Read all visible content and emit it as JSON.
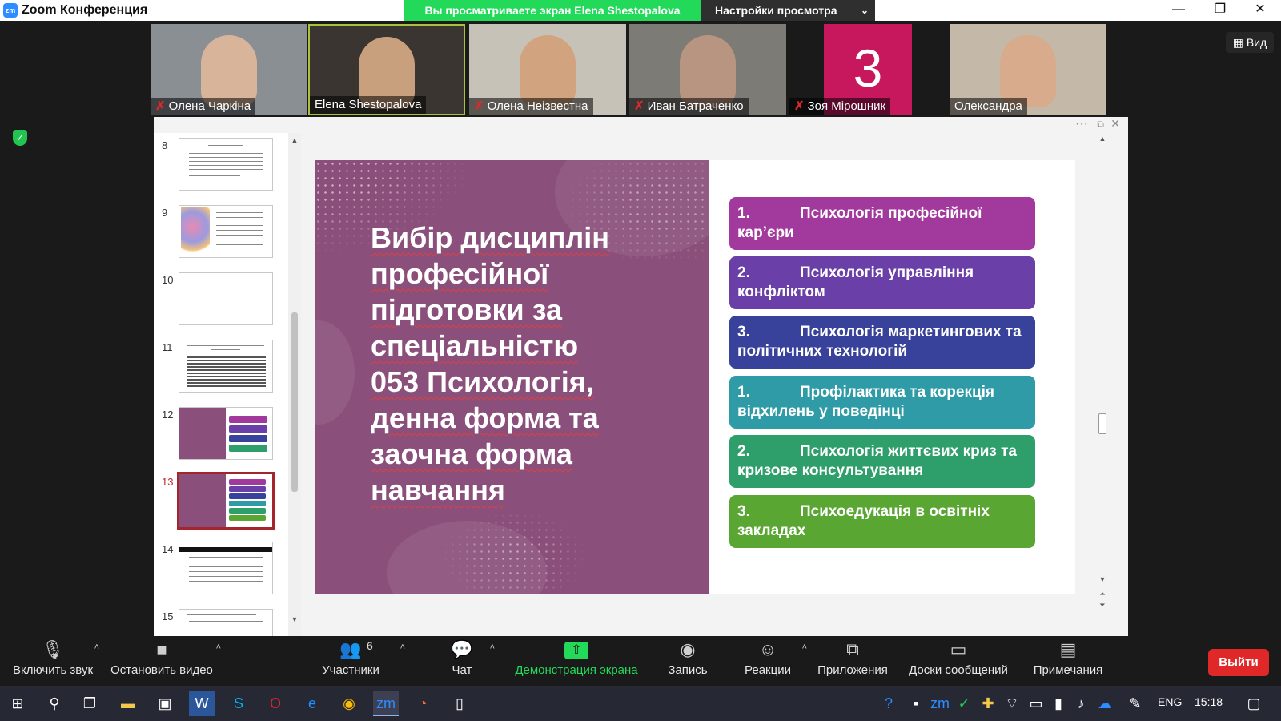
{
  "window": {
    "app_title": "Zoom Конференция",
    "minimize": "—",
    "restore": "❐",
    "close": "✕"
  },
  "share_bar": {
    "banner": "Вы просматриваете экран Elena Shestopalova",
    "view_settings": "Настройки просмотра",
    "chevron": "⌄"
  },
  "view_button": {
    "label": "▦ Вид"
  },
  "participants": [
    {
      "name": "Олена Чаркіна",
      "muted": true,
      "bg": "#8a8f94",
      "face": "#d8b59a"
    },
    {
      "name": "Elena Shestopalova",
      "muted": false,
      "active": true,
      "bg": "#3a3530",
      "face": "#c9a07e"
    },
    {
      "name": "Олена Неізвестна",
      "muted": true,
      "bg": "#c7c2b8",
      "face": "#d1a47f"
    },
    {
      "name": "Иван Батраченко",
      "muted": true,
      "bg": "#7c7b76",
      "face": "#b89580"
    },
    {
      "name": "Зоя Мірошник",
      "muted": true,
      "avatar": "3"
    },
    {
      "name": "Олександра",
      "muted": false,
      "bg": "#c4b8a8",
      "face": "#d8ab8c"
    }
  ],
  "mute_glyph": "✗",
  "thumbnails": [
    {
      "num": "8"
    },
    {
      "num": "9"
    },
    {
      "num": "10"
    },
    {
      "num": "11"
    },
    {
      "num": "12"
    },
    {
      "num": "13",
      "current": true
    },
    {
      "num": "14"
    },
    {
      "num": "15"
    }
  ],
  "slide": {
    "heading_lines": [
      "Вибір дисциплін",
      "професійної",
      "підготовки за",
      "спеціальністю",
      "053 Психологія,",
      "денна форма та",
      "заочна форма",
      "навчання"
    ],
    "items": [
      {
        "num": "1.",
        "text": "Психологія професійної кар’єри",
        "color": "#a23a9e"
      },
      {
        "num": "2.",
        "text": "Психологія управління конфліктом",
        "color": "#6a3fa8"
      },
      {
        "num": "3.",
        "text": "Психологія маркетингових та політичних технологій",
        "color": "#38429a"
      },
      {
        "num": "1.",
        "text": "Профілактика та корекція відхилень у поведінці",
        "color": "#2e9ba6"
      },
      {
        "num": "2.",
        "text": "Психологія життєвих криз та кризове консультування",
        "color": "#2e9f6a"
      },
      {
        "num": "3.",
        "text": "Психоедукація в освітніх закладах",
        "color": "#5aa632"
      }
    ]
  },
  "toolbar": {
    "mic": {
      "label": "Включить звук",
      "icon": "🎙"
    },
    "video": {
      "label": "Остановить видео",
      "icon": "■"
    },
    "participants": {
      "label": "Участники",
      "count": "6",
      "icon": "👥"
    },
    "chat": {
      "label": "Чат",
      "icon": "💬"
    },
    "share": {
      "label": "Демонстрация экрана",
      "icon": "⇧"
    },
    "record": {
      "label": "Запись",
      "icon": "◉"
    },
    "reactions": {
      "label": "Реакции",
      "icon": "☺"
    },
    "apps": {
      "label": "Приложения",
      "icon": "⧉"
    },
    "whiteboards": {
      "label": "Доски сообщений",
      "icon": "▭"
    },
    "notes": {
      "label": "Примечания",
      "icon": "▤"
    },
    "caret": "˄",
    "exit": "Выйти"
  },
  "taskbar": {
    "lang": "ENG",
    "time": "15:18"
  },
  "colors": {
    "accent_green": "#23d959",
    "exit_red": "#e02828",
    "slide_purple": "#8a4f7a"
  }
}
